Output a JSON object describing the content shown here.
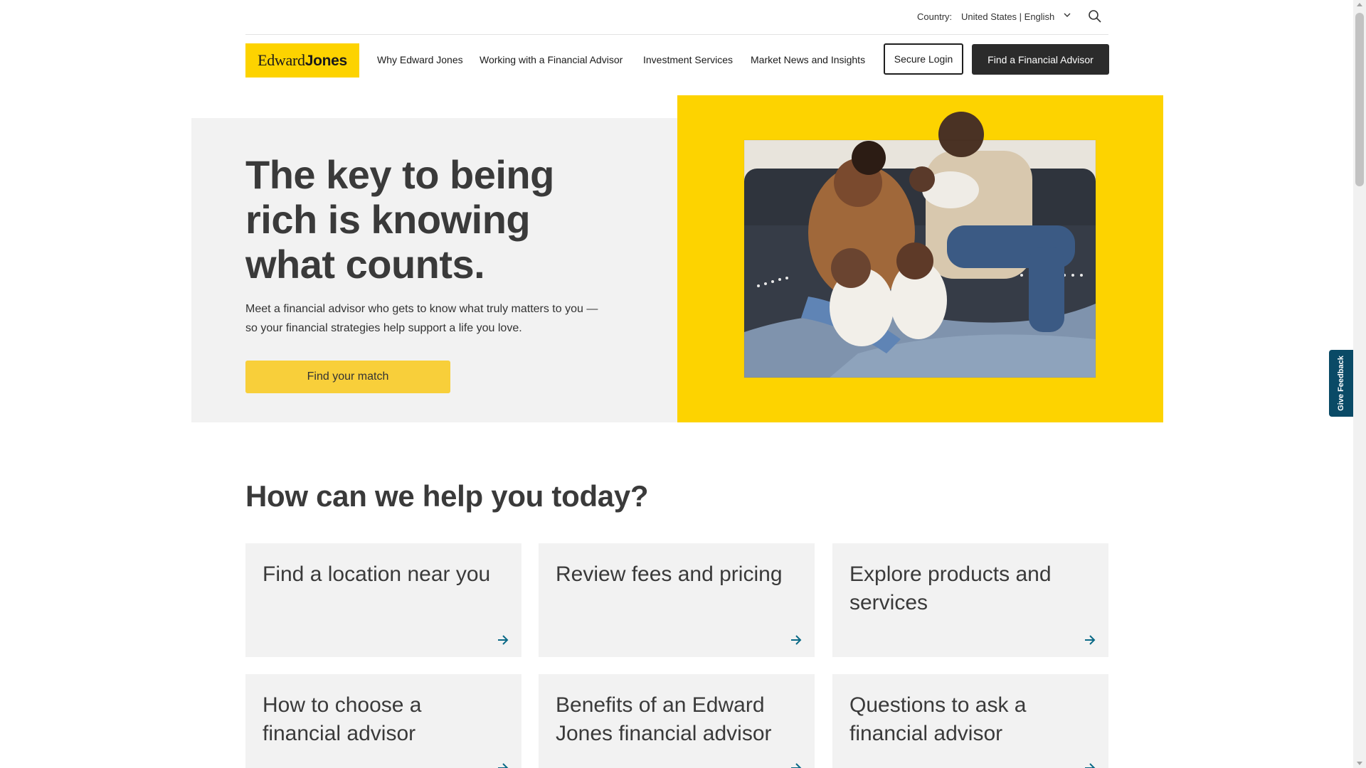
{
  "utility": {
    "country_label": "Country:",
    "country_value": "United States | English"
  },
  "header": {
    "logo_text_1": "Edward",
    "logo_text_2": "Jones",
    "nav": [
      "Why Edward Jones",
      "Working with a Financial Advisor",
      "Investment Services",
      "Market News and Insights"
    ],
    "login_label": "Secure Login",
    "find_advisor_label": "Find a Financial Advisor"
  },
  "hero": {
    "title": "The key to being rich is knowing what counts.",
    "subtitle": "Meet a financial advisor who gets to know what truly matters to you — so your financial strategies help support a life you love.",
    "cta_label": "Find your match"
  },
  "help": {
    "title": "How can we help you today?",
    "cards": [
      "Find a location near you",
      "Review fees and pricing",
      "Explore products and services",
      "How to choose a financial advisor",
      "Benefits of an Edward Jones financial advisor",
      "Questions to ask a financial advisor"
    ]
  },
  "feedback": {
    "label": "Give Feedback"
  },
  "colors": {
    "brand_yellow": "#fdd300",
    "button_yellow": "#f8cf3a",
    "dark_button": "#2b2b2b",
    "arrow_teal": "#0b6a87",
    "feedback_bg": "#0a4a66",
    "card_bg": "#f2f2f2"
  },
  "icons": {
    "search": "search-icon",
    "chevron": "chevron-down-icon",
    "arrow": "arrow-right-icon"
  }
}
